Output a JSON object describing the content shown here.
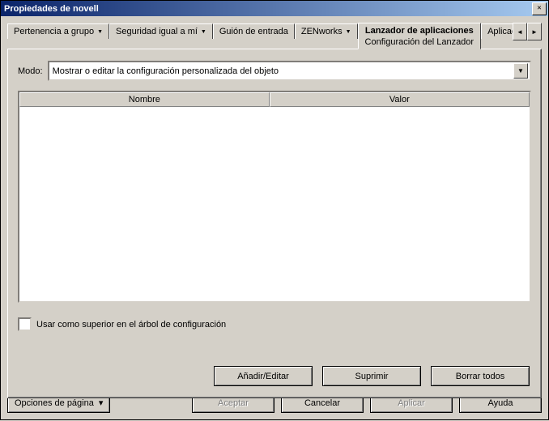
{
  "window": {
    "title": "Propiedades de novell"
  },
  "tabs": {
    "t0": "Pertenencia a grupo",
    "t1": "Seguridad igual a mí",
    "t2": "Guión de entrada",
    "t3": "ZENworks",
    "t4": "Lanzador de aplicaciones",
    "t4_sub": "Configuración del Lanzador",
    "t5": "Aplicac"
  },
  "form": {
    "modo_label": "Modo:",
    "modo_value": "Mostrar o editar la configuración personalizada del objeto",
    "col_nombre": "Nombre",
    "col_valor": "Valor",
    "chk_label": "Usar como superior en el árbol de configuración"
  },
  "panel_buttons": {
    "add_edit": "Añadir/Editar",
    "suprimir": "Suprimir",
    "borrar_todos": "Borrar todos"
  },
  "dialog_buttons": {
    "opciones": "Opciones de página",
    "aceptar": "Aceptar",
    "cancelar": "Cancelar",
    "aplicar": "Aplicar",
    "ayuda": "Ayuda"
  }
}
